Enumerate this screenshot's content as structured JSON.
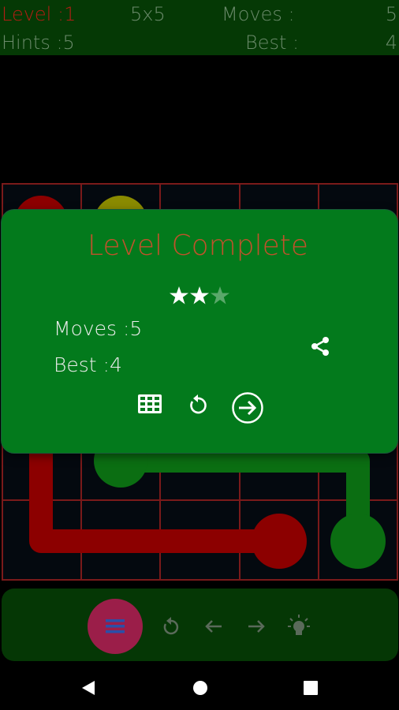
{
  "header": {
    "level": "Level :1",
    "size": "5x5",
    "moves_label": "Moves :",
    "moves_value": "5",
    "hints": "Hints :5",
    "best_label": "Best :",
    "best_value": "4"
  },
  "dialog": {
    "title": "Level Complete",
    "stars_earned": 2,
    "stars_total": 3,
    "moves": "Moves :5",
    "best": "Best :4"
  },
  "icons": {
    "share": "share-icon",
    "grid": "grid-icon",
    "replay": "replay-icon",
    "next": "arrow-right-circle-icon",
    "menu": "menu-icon",
    "undo": "undo-icon",
    "previous": "arrow-left-icon",
    "forward": "arrow-right-icon",
    "hint": "lightbulb-icon"
  },
  "colors": {
    "header_bg": "#053905",
    "dialog_bg": "#037a1c",
    "title": "#c0522b",
    "red_flow": "#8c0000",
    "green_flow": "#0b6e12",
    "yellow_flow": "#8a8a00",
    "fab": "#9b1e49",
    "grid_line": "#7a1a1a"
  }
}
